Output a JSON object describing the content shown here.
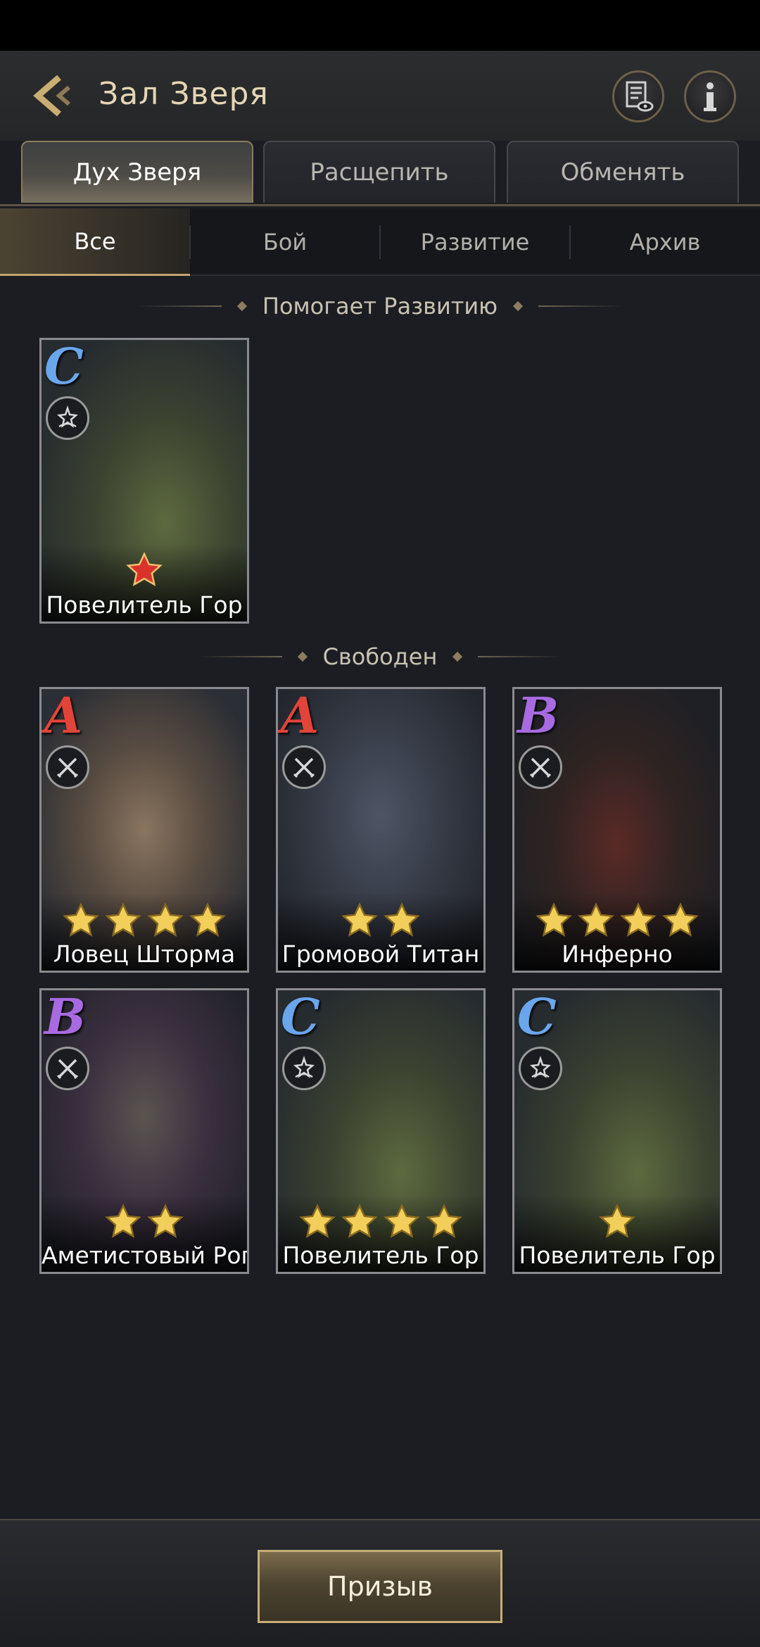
{
  "header": {
    "title": "Зал Зверя"
  },
  "tabs": [
    {
      "label": "Дух Зверя"
    },
    {
      "label": "Расщепить"
    },
    {
      "label": "Обменять"
    }
  ],
  "filters": [
    {
      "label": "Все"
    },
    {
      "label": "Бой"
    },
    {
      "label": "Развитие"
    },
    {
      "label": "Архив"
    }
  ],
  "sections": {
    "assisting": "Помогает Развитию",
    "free": "Свободен"
  },
  "cards": [
    {
      "grade": "C",
      "role": "growth-icon",
      "stars": 1,
      "star_type": "red",
      "name": "Повелитель Гор"
    },
    {
      "grade": "A",
      "role": "combat-icon",
      "stars": 4,
      "star_type": "gold",
      "name": "Ловец Шторма"
    },
    {
      "grade": "A",
      "role": "combat-icon",
      "stars": 2,
      "star_type": "gold",
      "name": "Громовой Титан"
    },
    {
      "grade": "B",
      "role": "combat-icon",
      "stars": 4,
      "star_type": "gold",
      "name": "Инферно"
    },
    {
      "grade": "B",
      "role": "combat-icon",
      "stars": 2,
      "star_type": "gold",
      "name": "Аметистовый Рог"
    },
    {
      "grade": "C",
      "role": "growth-icon",
      "stars": 4,
      "star_type": "gold",
      "name": "Повелитель Гор"
    },
    {
      "grade": "C",
      "role": "growth-icon",
      "stars": 1,
      "star_type": "gold",
      "name": "Повелитель Гор"
    }
  ],
  "colors": {
    "grade_A": "#e2443a",
    "grade_B": "#a86ae0",
    "grade_C": "#6aa6ec",
    "accent": "#c2a66e"
  },
  "bottom": {
    "summon_label": "Призыв"
  }
}
